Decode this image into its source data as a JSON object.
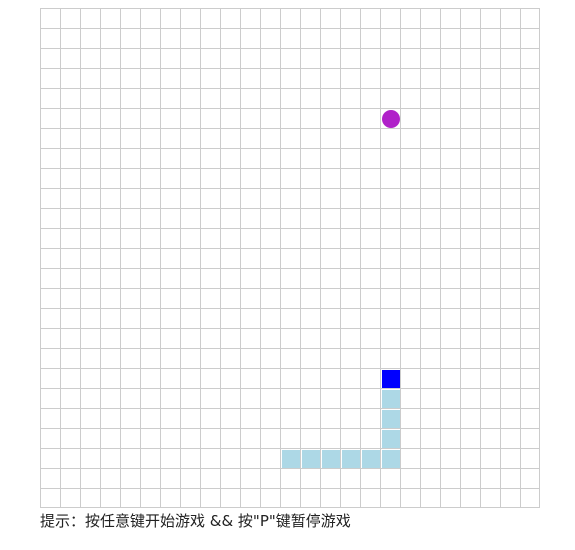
{
  "board": {
    "columns": 25,
    "rows": 25
  },
  "snake": {
    "head_color": "#0000ff",
    "body_color": "#add8e6",
    "head": {
      "col": 17,
      "row": 18
    },
    "body": [
      {
        "col": 17,
        "row": 19
      },
      {
        "col": 17,
        "row": 20
      },
      {
        "col": 17,
        "row": 21
      },
      {
        "col": 17,
        "row": 22
      },
      {
        "col": 16,
        "row": 22
      },
      {
        "col": 15,
        "row": 22
      },
      {
        "col": 14,
        "row": 22
      },
      {
        "col": 13,
        "row": 22
      },
      {
        "col": 12,
        "row": 22
      }
    ]
  },
  "food": {
    "color": "#b021c9",
    "col": 17,
    "row": 5
  },
  "hint": {
    "text": "提示：按任意键开始游戏 && 按\"P\"键暂停游戏"
  }
}
